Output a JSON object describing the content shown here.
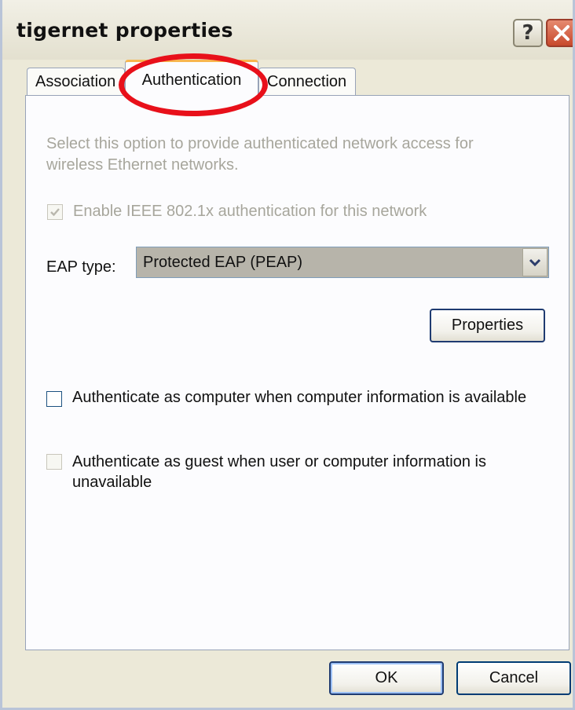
{
  "window": {
    "title": "tigernet properties"
  },
  "tabs": [
    {
      "label": "Association",
      "selected": false
    },
    {
      "label": "Authentication",
      "selected": true
    },
    {
      "label": "Connection",
      "selected": false
    }
  ],
  "authentication": {
    "info_text": "Select this option to provide authenticated network access for wireless Ethernet networks.",
    "enable_8021x": {
      "label": "Enable IEEE 802.1x authentication for this network",
      "checked": true,
      "disabled": true
    },
    "eap_type": {
      "label": "EAP type:",
      "selected": "Protected EAP (PEAP)"
    },
    "properties_button": "Properties",
    "auth_as_computer": {
      "label": "Authenticate as computer when computer information is available",
      "checked": false
    },
    "auth_as_guest": {
      "label": "Authenticate as guest when user or computer information is unavailable",
      "checked": false,
      "disabled": true
    }
  },
  "buttons": {
    "ok": "OK",
    "cancel": "Cancel"
  },
  "colors": {
    "highlight": "#e8101a",
    "dialog_bg": "#ece9d8",
    "panel_bg": "#fcfcfe",
    "disabled_text": "#a7a69c"
  }
}
